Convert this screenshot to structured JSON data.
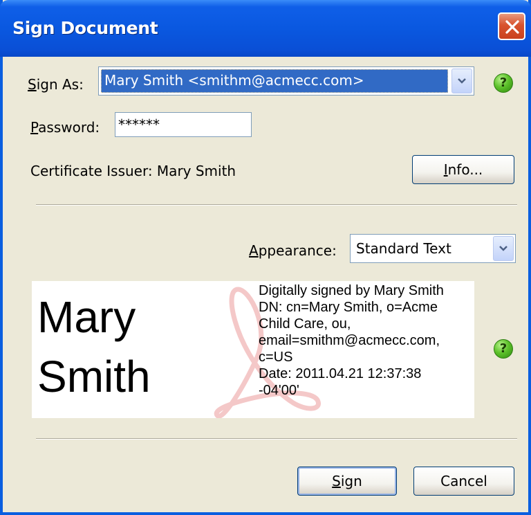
{
  "dialog": {
    "title": "Sign Document"
  },
  "sign_as": {
    "label_prefix": "S",
    "label_rest": "ign As:",
    "value": "Mary Smith <smithm@acmecc.com>"
  },
  "password": {
    "label_prefix": "P",
    "label_rest": "assword:",
    "value": "******"
  },
  "certificate": {
    "issuer_text": "Certificate Issuer: Mary Smith"
  },
  "info_button": {
    "prefix": "I",
    "rest": "nfo..."
  },
  "appearance": {
    "label_prefix": "A",
    "label_rest": "ppearance:",
    "value": "Standard Text"
  },
  "signature_preview": {
    "name_line1": "Mary",
    "name_line2": "Smith",
    "detail_lines": [
      "Digitally signed by Mary Smith",
      "DN: cn=Mary Smith, o=Acme",
      "Child Care, ou,",
      "email=smithm@acmecc.com,",
      "c=US",
      "Date: 2011.04.21 12:37:38",
      "-04'00'"
    ]
  },
  "buttons": {
    "sign_prefix": "S",
    "sign_rest": "ign",
    "cancel": "Cancel"
  },
  "colors": {
    "titlebar": "#0A58E0",
    "selection": "#316AC5",
    "help_icon": "#5EC22B",
    "close": "#D8532E"
  }
}
